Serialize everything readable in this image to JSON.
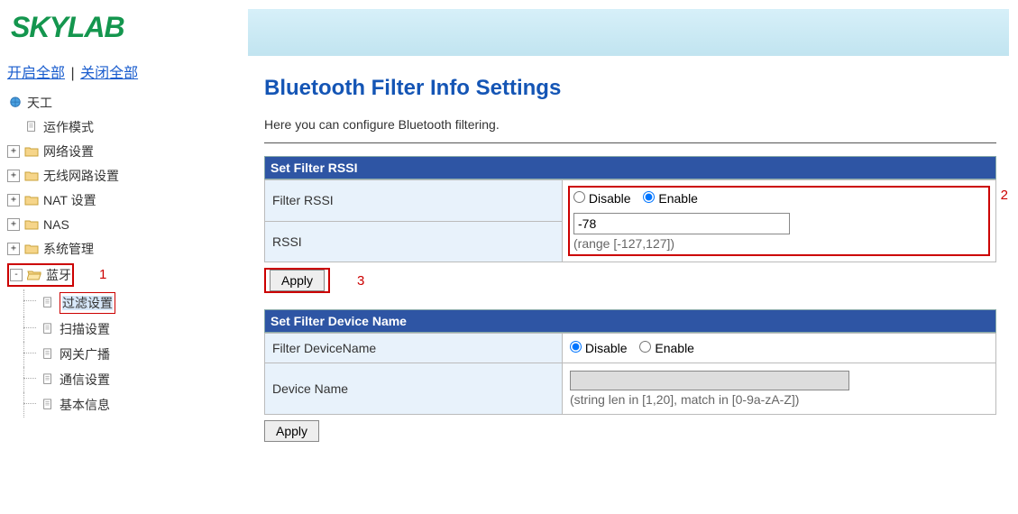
{
  "brand": "SKYLAB",
  "tree_ctrl": {
    "open_all": "开启全部",
    "close_all": "关闭全部"
  },
  "tree": {
    "root": "天工",
    "items": [
      {
        "label": "运作模式",
        "icon": "page",
        "toggle": ""
      },
      {
        "label": "网络设置",
        "icon": "folder",
        "toggle": "+"
      },
      {
        "label": "无线网路设置",
        "icon": "folder",
        "toggle": "+"
      },
      {
        "label": "NAT 设置",
        "icon": "folder",
        "toggle": "+"
      },
      {
        "label": "NAS",
        "icon": "folder",
        "toggle": "+"
      },
      {
        "label": "系统管理",
        "icon": "folder",
        "toggle": "+"
      },
      {
        "label": "蓝牙",
        "icon": "folder-open",
        "toggle": "-",
        "children": [
          {
            "label": "过滤设置",
            "selected": true
          },
          {
            "label": "扫描设置"
          },
          {
            "label": "网关广播"
          },
          {
            "label": "通信设置"
          },
          {
            "label": "基本信息"
          }
        ]
      }
    ]
  },
  "page": {
    "title": "Bluetooth Filter Info Settings",
    "desc": "Here you can configure Bluetooth filtering."
  },
  "rssi": {
    "section_title": "Set Filter RSSI",
    "row1_label": "Filter RSSI",
    "disable": "Disable",
    "enable": "Enable",
    "row2_label": "RSSI",
    "value": "-78",
    "hint": "(range [-127,127])",
    "apply": "Apply"
  },
  "dev": {
    "section_title": "Set Filter Device Name",
    "row1_label": "Filter DeviceName",
    "disable": "Disable",
    "enable": "Enable",
    "row2_label": "Device Name",
    "hint": "(string len in [1,20], match in [0-9a-zA-Z])",
    "apply": "Apply"
  },
  "annot": {
    "one": "1",
    "two": "2",
    "three": "3"
  }
}
